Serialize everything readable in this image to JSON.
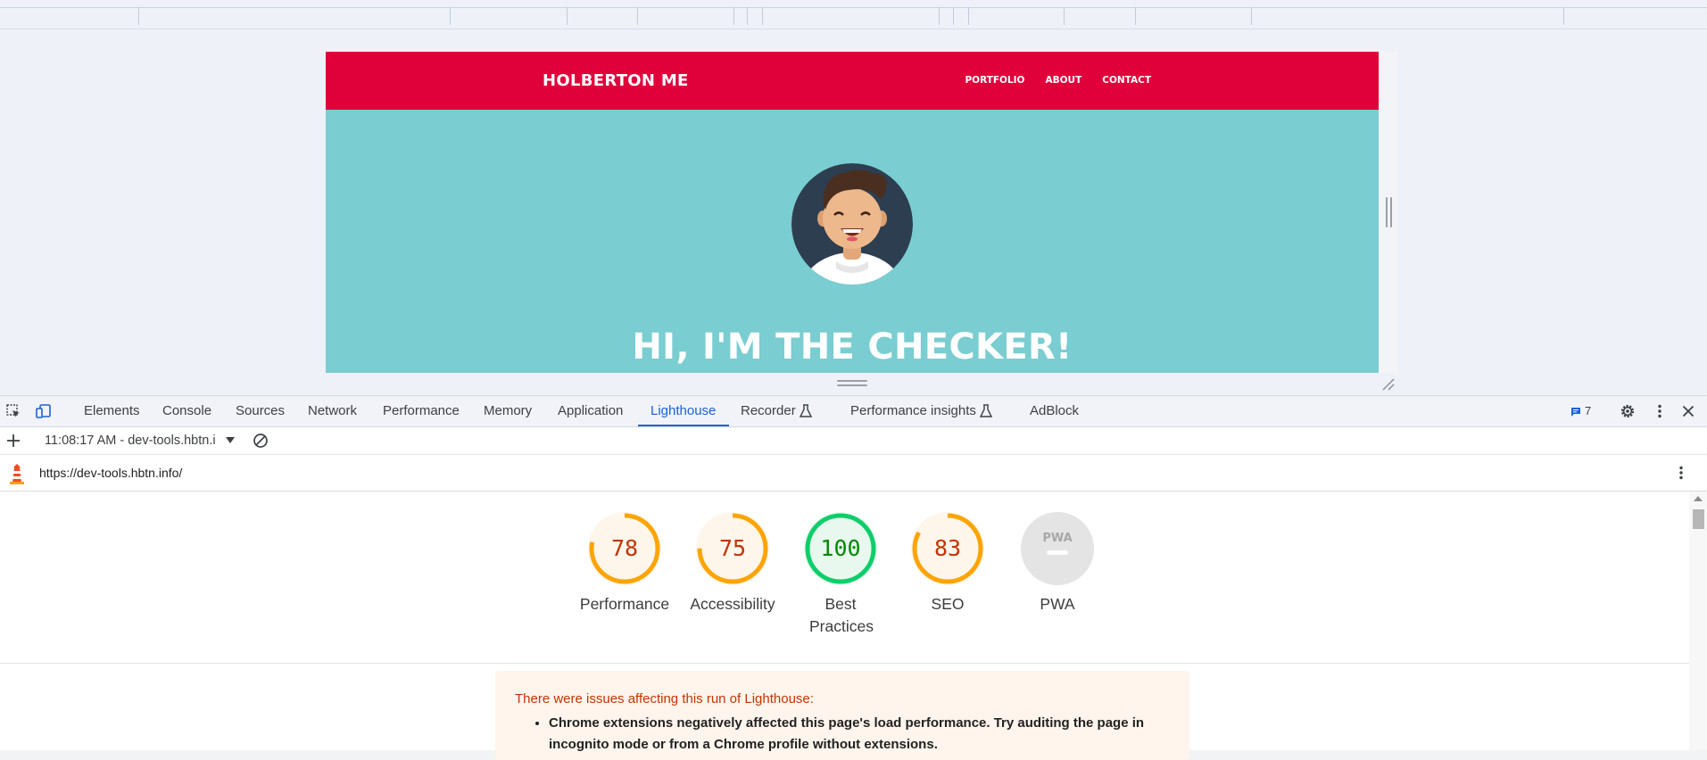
{
  "site": {
    "logo": "HOLBERTON ME",
    "nav": [
      "PORTFOLIO",
      "ABOUT",
      "CONTACT"
    ],
    "hero_title": "HI, I'M THE CHECKER!"
  },
  "devtools": {
    "tabs": [
      "Elements",
      "Console",
      "Sources",
      "Network",
      "Performance",
      "Memory",
      "Application",
      "Lighthouse",
      "Recorder",
      "Performance insights",
      "AdBlock"
    ],
    "active_tab": "Lighthouse",
    "issues_count": "7",
    "accent": "#1a62d6"
  },
  "lighthouse": {
    "report_select": "11:08:17 AM - dev-tools.hbtn.i",
    "url": "https://dev-tools.hbtn.info/",
    "scores": [
      {
        "label": "Performance",
        "value": 78,
        "color": "#ffa400"
      },
      {
        "label": "Accessibility",
        "value": 75,
        "color": "#ffa400"
      },
      {
        "label": "Best Practices",
        "value": 100,
        "color": "#0cce6b"
      },
      {
        "label": "SEO",
        "value": 83,
        "color": "#ffa400"
      }
    ],
    "pwa": {
      "label": "PWA",
      "badge": "PWA"
    },
    "warning": {
      "title": "There were issues affecting this run of Lighthouse:",
      "items": [
        "Chrome extensions negatively affected this page's load performance. Try auditing the page in incognito mode or from a Chrome profile without extensions."
      ]
    }
  }
}
